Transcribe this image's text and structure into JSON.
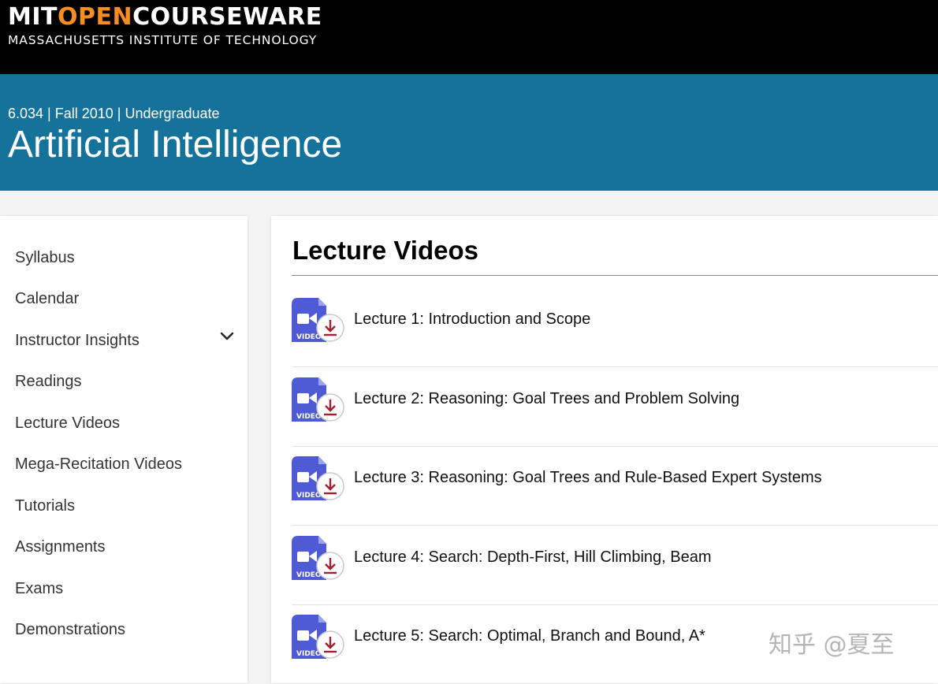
{
  "header": {
    "logo_part1": "MIT",
    "logo_part2": "OPEN",
    "logo_part3": "COURSEWARE",
    "logo_subtitle": "MASSACHUSETTS INSTITUTE OF TECHNOLOGY"
  },
  "course": {
    "meta": "6.034 | Fall 2010 | Undergraduate",
    "title": "Artificial Intelligence"
  },
  "sidebar": {
    "items": [
      {
        "label": "Syllabus"
      },
      {
        "label": "Calendar"
      },
      {
        "label": "Instructor Insights",
        "expandable": true
      },
      {
        "label": "Readings"
      },
      {
        "label": "Lecture Videos"
      },
      {
        "label": "Mega-Recitation Videos"
      },
      {
        "label": "Tutorials"
      },
      {
        "label": "Assignments"
      },
      {
        "label": "Exams"
      },
      {
        "label": "Demonstrations"
      }
    ]
  },
  "main": {
    "title": "Lecture Videos",
    "video_icon_text": "VIDEO",
    "lectures": [
      {
        "title": "Lecture 1: Introduction and Scope"
      },
      {
        "title": "Lecture 2: Reasoning: Goal Trees and Problem Solving"
      },
      {
        "title": "Lecture 3: Reasoning: Goal Trees and Rule-Based Expert Systems"
      },
      {
        "title": "Lecture 4: Search: Depth-First, Hill Climbing, Beam"
      },
      {
        "title": "Lecture 5: Search: Optimal, Branch and Bound, A*"
      }
    ]
  },
  "watermark": "知乎 @夏至",
  "colors": {
    "topbar": "#000000",
    "logo_accent": "#f78d1e",
    "banner": "#15729b",
    "video_icon_blue": "#4f5bd5",
    "download_red": "#a31f34"
  }
}
